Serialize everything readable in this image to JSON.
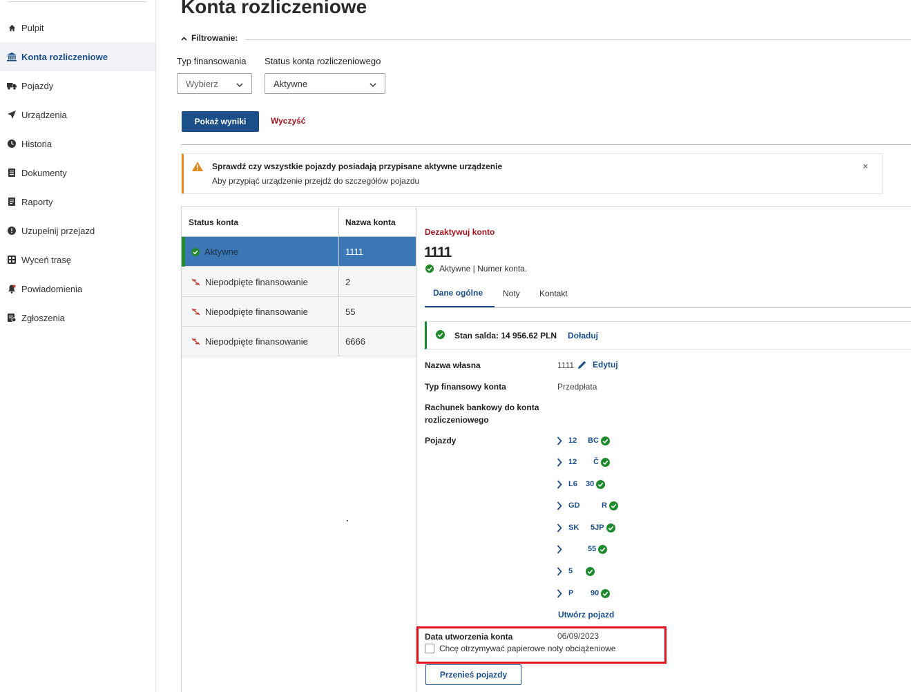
{
  "page": {
    "title": "Konta rozliczeniowe"
  },
  "sidebar": {
    "items": [
      {
        "label": "Pulpit",
        "icon": "home-icon"
      },
      {
        "label": "Konta rozliczeniowe",
        "icon": "bank-icon",
        "active": true
      },
      {
        "label": "Pojazdy",
        "icon": "truck-icon"
      },
      {
        "label": "Urządzenia",
        "icon": "location-arrow-icon"
      },
      {
        "label": "Historia",
        "icon": "clock-icon"
      },
      {
        "label": "Dokumenty",
        "icon": "document-icon"
      },
      {
        "label": "Raporty",
        "icon": "report-icon"
      },
      {
        "label": "Uzupełnij przejazd",
        "icon": "exclamation-circle-icon"
      },
      {
        "label": "Wyceń trasę",
        "icon": "calculator-icon"
      },
      {
        "label": "Powiadomienia",
        "icon": "bell-icon"
      },
      {
        "label": "Zgłoszenia",
        "icon": "ticket-icon"
      }
    ]
  },
  "filters": {
    "heading": "Filtrowanie:",
    "financing_type": {
      "label": "Typ finansowania",
      "value": "Wybierz"
    },
    "account_status": {
      "label": "Status konta rozliczeniowego",
      "value": "Aktywne"
    },
    "show_results": "Pokaż wyniki",
    "clear": "Wyczyść"
  },
  "alert": {
    "title": "Sprawdź czy wszystkie pojazdy posiadają przypisane aktywne urządzenie",
    "text": "Aby przypiąć urządzenie przejdź do szczegółów pojazdu",
    "close": "×"
  },
  "accounts_table": {
    "headers": {
      "status": "Status konta",
      "name": "Nazwa konta"
    },
    "rows": [
      {
        "status": "Aktywne",
        "name": "1111",
        "selected": true
      },
      {
        "status": "Niepodpięte finansowanie",
        "name": "2"
      },
      {
        "status": "Niepodpięte finansowanie",
        "name": "55"
      },
      {
        "status": "Niepodpięte finansowanie",
        "name": "6666"
      }
    ]
  },
  "detail": {
    "deactivate": "Dezaktywuj konto",
    "account_name": "1111",
    "status_text": "Aktywne | Numer konta.",
    "tabs": [
      "Dane ogólne",
      "Noty",
      "Kontakt"
    ],
    "balance": {
      "text": "Stan salda: 14 956.62 PLN",
      "top_up": "Doładuj"
    },
    "own_name": {
      "label": "Nazwa własna",
      "value": "1111",
      "edit": "Edytuj"
    },
    "account_type": {
      "label": "Typ finansowy konta",
      "value": "Przedpłata"
    },
    "bank_account": {
      "label": "Rachunek bankowy do konta rozliczeniowego"
    },
    "vehicles": {
      "label": "Pojazdy",
      "items": [
        {
          "p1": "12",
          "p2": "BC"
        },
        {
          "p1": "12",
          "p2": "Č"
        },
        {
          "p1": "L6",
          "p2": "30"
        },
        {
          "p1": "GD",
          "p2": "R"
        },
        {
          "p1": "SK",
          "p2": "5JP"
        },
        {
          "p1": "",
          "p2": "55"
        },
        {
          "p1": "5",
          "p2": ""
        },
        {
          "p1": "P",
          "p2": "90"
        }
      ],
      "create": "Utwórz pojazd"
    },
    "created": {
      "label": "Data utworzenia konta",
      "value": "06/09/2023"
    },
    "paper_notes": "Chcę otrzymywać papierowe noty obciążeniowe",
    "move_vehicles": "Przenieś pojazdy"
  },
  "colors": {
    "brand": "#1b4f8a",
    "danger": "#a0151e",
    "success": "#1f8a2b",
    "warning": "#e08a1e",
    "selected_row": "#3b77b4",
    "highlight_box": "#e0131f"
  }
}
